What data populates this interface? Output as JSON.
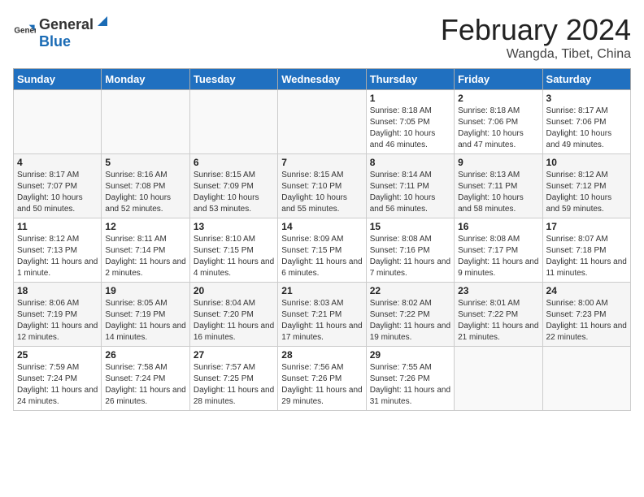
{
  "header": {
    "logo_general": "General",
    "logo_blue": "Blue",
    "month_year": "February 2024",
    "location": "Wangda, Tibet, China"
  },
  "weekdays": [
    "Sunday",
    "Monday",
    "Tuesday",
    "Wednesday",
    "Thursday",
    "Friday",
    "Saturday"
  ],
  "weeks": [
    [
      {
        "day": "",
        "sunrise": "",
        "sunset": "",
        "daylight": ""
      },
      {
        "day": "",
        "sunrise": "",
        "sunset": "",
        "daylight": ""
      },
      {
        "day": "",
        "sunrise": "",
        "sunset": "",
        "daylight": ""
      },
      {
        "day": "",
        "sunrise": "",
        "sunset": "",
        "daylight": ""
      },
      {
        "day": "1",
        "sunrise": "Sunrise: 8:18 AM",
        "sunset": "Sunset: 7:05 PM",
        "daylight": "Daylight: 10 hours and 46 minutes."
      },
      {
        "day": "2",
        "sunrise": "Sunrise: 8:18 AM",
        "sunset": "Sunset: 7:06 PM",
        "daylight": "Daylight: 10 hours and 47 minutes."
      },
      {
        "day": "3",
        "sunrise": "Sunrise: 8:17 AM",
        "sunset": "Sunset: 7:06 PM",
        "daylight": "Daylight: 10 hours and 49 minutes."
      }
    ],
    [
      {
        "day": "4",
        "sunrise": "Sunrise: 8:17 AM",
        "sunset": "Sunset: 7:07 PM",
        "daylight": "Daylight: 10 hours and 50 minutes."
      },
      {
        "day": "5",
        "sunrise": "Sunrise: 8:16 AM",
        "sunset": "Sunset: 7:08 PM",
        "daylight": "Daylight: 10 hours and 52 minutes."
      },
      {
        "day": "6",
        "sunrise": "Sunrise: 8:15 AM",
        "sunset": "Sunset: 7:09 PM",
        "daylight": "Daylight: 10 hours and 53 minutes."
      },
      {
        "day": "7",
        "sunrise": "Sunrise: 8:15 AM",
        "sunset": "Sunset: 7:10 PM",
        "daylight": "Daylight: 10 hours and 55 minutes."
      },
      {
        "day": "8",
        "sunrise": "Sunrise: 8:14 AM",
        "sunset": "Sunset: 7:11 PM",
        "daylight": "Daylight: 10 hours and 56 minutes."
      },
      {
        "day": "9",
        "sunrise": "Sunrise: 8:13 AM",
        "sunset": "Sunset: 7:11 PM",
        "daylight": "Daylight: 10 hours and 58 minutes."
      },
      {
        "day": "10",
        "sunrise": "Sunrise: 8:12 AM",
        "sunset": "Sunset: 7:12 PM",
        "daylight": "Daylight: 10 hours and 59 minutes."
      }
    ],
    [
      {
        "day": "11",
        "sunrise": "Sunrise: 8:12 AM",
        "sunset": "Sunset: 7:13 PM",
        "daylight": "Daylight: 11 hours and 1 minute."
      },
      {
        "day": "12",
        "sunrise": "Sunrise: 8:11 AM",
        "sunset": "Sunset: 7:14 PM",
        "daylight": "Daylight: 11 hours and 2 minutes."
      },
      {
        "day": "13",
        "sunrise": "Sunrise: 8:10 AM",
        "sunset": "Sunset: 7:15 PM",
        "daylight": "Daylight: 11 hours and 4 minutes."
      },
      {
        "day": "14",
        "sunrise": "Sunrise: 8:09 AM",
        "sunset": "Sunset: 7:15 PM",
        "daylight": "Daylight: 11 hours and 6 minutes."
      },
      {
        "day": "15",
        "sunrise": "Sunrise: 8:08 AM",
        "sunset": "Sunset: 7:16 PM",
        "daylight": "Daylight: 11 hours and 7 minutes."
      },
      {
        "day": "16",
        "sunrise": "Sunrise: 8:08 AM",
        "sunset": "Sunset: 7:17 PM",
        "daylight": "Daylight: 11 hours and 9 minutes."
      },
      {
        "day": "17",
        "sunrise": "Sunrise: 8:07 AM",
        "sunset": "Sunset: 7:18 PM",
        "daylight": "Daylight: 11 hours and 11 minutes."
      }
    ],
    [
      {
        "day": "18",
        "sunrise": "Sunrise: 8:06 AM",
        "sunset": "Sunset: 7:19 PM",
        "daylight": "Daylight: 11 hours and 12 minutes."
      },
      {
        "day": "19",
        "sunrise": "Sunrise: 8:05 AM",
        "sunset": "Sunset: 7:19 PM",
        "daylight": "Daylight: 11 hours and 14 minutes."
      },
      {
        "day": "20",
        "sunrise": "Sunrise: 8:04 AM",
        "sunset": "Sunset: 7:20 PM",
        "daylight": "Daylight: 11 hours and 16 minutes."
      },
      {
        "day": "21",
        "sunrise": "Sunrise: 8:03 AM",
        "sunset": "Sunset: 7:21 PM",
        "daylight": "Daylight: 11 hours and 17 minutes."
      },
      {
        "day": "22",
        "sunrise": "Sunrise: 8:02 AM",
        "sunset": "Sunset: 7:22 PM",
        "daylight": "Daylight: 11 hours and 19 minutes."
      },
      {
        "day": "23",
        "sunrise": "Sunrise: 8:01 AM",
        "sunset": "Sunset: 7:22 PM",
        "daylight": "Daylight: 11 hours and 21 minutes."
      },
      {
        "day": "24",
        "sunrise": "Sunrise: 8:00 AM",
        "sunset": "Sunset: 7:23 PM",
        "daylight": "Daylight: 11 hours and 22 minutes."
      }
    ],
    [
      {
        "day": "25",
        "sunrise": "Sunrise: 7:59 AM",
        "sunset": "Sunset: 7:24 PM",
        "daylight": "Daylight: 11 hours and 24 minutes."
      },
      {
        "day": "26",
        "sunrise": "Sunrise: 7:58 AM",
        "sunset": "Sunset: 7:24 PM",
        "daylight": "Daylight: 11 hours and 26 minutes."
      },
      {
        "day": "27",
        "sunrise": "Sunrise: 7:57 AM",
        "sunset": "Sunset: 7:25 PM",
        "daylight": "Daylight: 11 hours and 28 minutes."
      },
      {
        "day": "28",
        "sunrise": "Sunrise: 7:56 AM",
        "sunset": "Sunset: 7:26 PM",
        "daylight": "Daylight: 11 hours and 29 minutes."
      },
      {
        "day": "29",
        "sunrise": "Sunrise: 7:55 AM",
        "sunset": "Sunset: 7:26 PM",
        "daylight": "Daylight: 11 hours and 31 minutes."
      },
      {
        "day": "",
        "sunrise": "",
        "sunset": "",
        "daylight": ""
      },
      {
        "day": "",
        "sunrise": "",
        "sunset": "",
        "daylight": ""
      }
    ]
  ]
}
